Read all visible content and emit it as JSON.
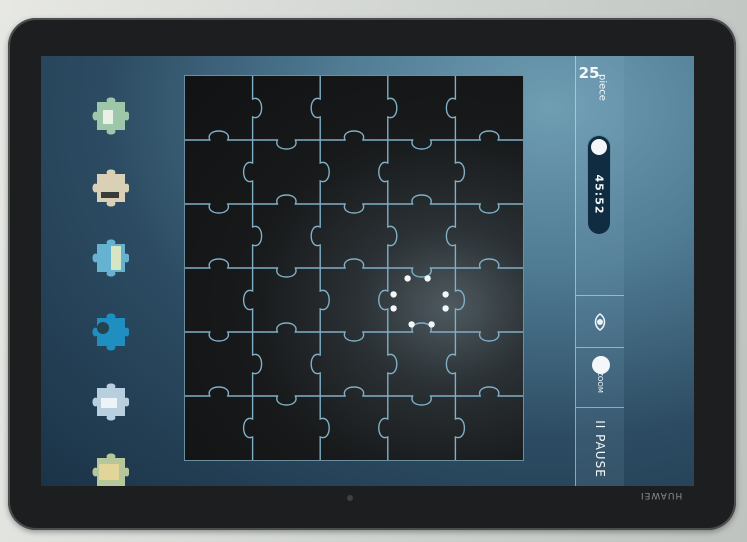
{
  "game": {
    "piece_label": "piece",
    "piece_count": "25",
    "timer": "45:52",
    "pause_label": "II PAUSE",
    "zoom_label": "ZOOM"
  },
  "device": {
    "brand": "HUAWEI"
  },
  "colors": {
    "screen_bg": "#2c4b62",
    "board_bg": "#17191a",
    "grid_line": "#7fb0c6",
    "hint_dot": "#f3f7fa"
  },
  "board": {
    "rows": 6,
    "cols": 5
  },
  "tray": {
    "pieces": [
      {
        "name": "tray-piece-1",
        "color": "#9ec6a8"
      },
      {
        "name": "tray-piece-2",
        "color": "#d9d0b5"
      },
      {
        "name": "tray-piece-3",
        "color": "#66b3d1"
      },
      {
        "name": "tray-piece-4",
        "color": "#1f8fc2"
      },
      {
        "name": "tray-piece-5",
        "color": "#b8cfe0"
      },
      {
        "name": "tray-piece-6",
        "color": "#b7c79c"
      }
    ]
  }
}
